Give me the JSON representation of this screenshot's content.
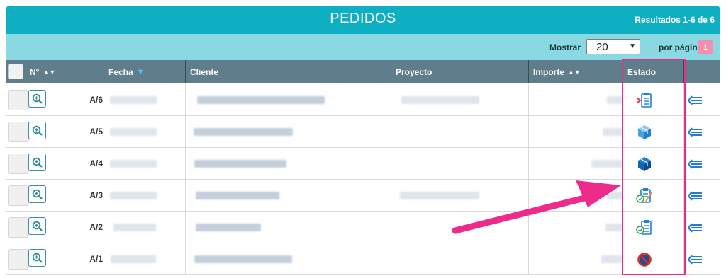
{
  "header": {
    "title": "PEDIDOS",
    "results": "Resultados 1-6 de 6"
  },
  "toolbar": {
    "show_label": "Mostrar",
    "page_size": "20",
    "per_page_label": "por página",
    "current_page": "1"
  },
  "table": {
    "columns": [
      {
        "label": "N°",
        "sort": "sortable"
      },
      {
        "label": "Fecha",
        "sort": "descending"
      },
      {
        "label": "Cliente",
        "sort": "none"
      },
      {
        "label": "Proyecto",
        "sort": "none"
      },
      {
        "label": "Importe",
        "sort": "sortable"
      },
      {
        "label": "Estado",
        "sort": "none"
      }
    ],
    "rows": [
      {
        "number": "A/6",
        "status_icon": "clipboard-pending-icon"
      },
      {
        "number": "A/5",
        "status_icon": "package-light-icon"
      },
      {
        "number": "A/4",
        "status_icon": "package-icon"
      },
      {
        "number": "A/3",
        "status_icon": "clipboard-approved-edit-icon"
      },
      {
        "number": "A/2",
        "status_icon": "clipboard-approved-icon"
      },
      {
        "number": "A/1",
        "status_icon": "cancelled-icon"
      }
    ]
  },
  "colors": {
    "accent": "#0eaec3",
    "toolbar": "#8ad9e2",
    "table_header": "#607d8b",
    "highlight": "#ee2a8a",
    "icon_blue": "#1f7fd4"
  }
}
